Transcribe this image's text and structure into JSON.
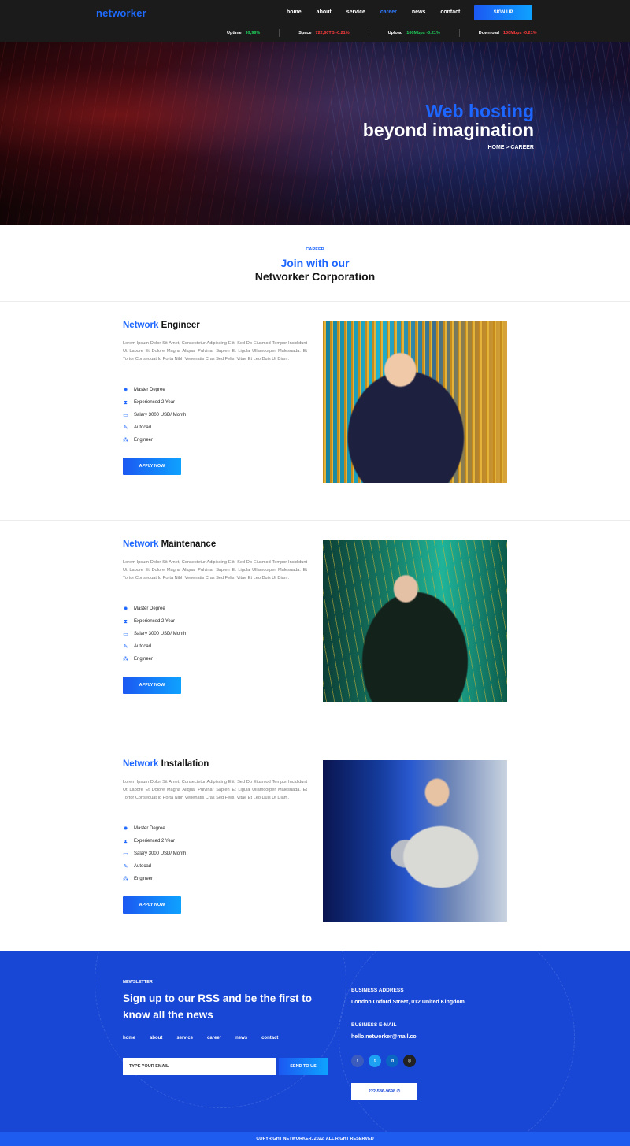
{
  "header": {
    "logo": "networker",
    "nav": [
      "home",
      "about",
      "service",
      "career",
      "news",
      "contact"
    ],
    "active_nav": "career",
    "signup_label": "SIGN UP",
    "stats": [
      {
        "label": "Uptime",
        "value": "99,99%",
        "color": "green"
      },
      {
        "label": "Space",
        "value": "722,60TB -0.21%",
        "color": "red"
      },
      {
        "label": "Upload",
        "value": "100Mbps -0.21%",
        "color": "green"
      },
      {
        "label": "Download",
        "value": "100Mbps -0.21%",
        "color": "red"
      }
    ]
  },
  "hero": {
    "title_line1": "Web hosting",
    "title_line2": "beyond imagination",
    "breadcrumb": "HOME > CAREER"
  },
  "intro": {
    "label": "CAREER",
    "title_line1": "Join with our",
    "title_line2": "Networker Corporation"
  },
  "jobs": [
    {
      "title_blue": "Network",
      "title_rest": " Engineer",
      "description": "Lorem Ipsum Dolor Sit Amet, Consectetur Adipiscing Elit, Sed Do Eiusmod Tempor Incididunt Ut Labore Et Dolore Magna Aliqua. Pulvinar Sapien Et Ligula Ullamcorper Malesuada. Et Tortor Consequat Id Porta Nibh Venenatis Cras Sed Felis. Vitae Et Leo Duis Ut Diam.",
      "features": [
        "Master Degree",
        "Experienced 2 Year",
        "Salary 3000 USD/ Month",
        "Autocad",
        "Engineer"
      ],
      "apply_label": "APPLY NOW"
    },
    {
      "title_blue": "Network",
      "title_rest": " Maintenance",
      "description": "Lorem Ipsum Dolor Sit Amet, Consectetur Adipiscing Elit, Sed Do Eiusmod Tempor Incididunt Ut Labore Et Dolore Magna Aliqua. Pulvinar Sapien Et Ligula Ullamcorper Malesuada. Et Tortor Consequat Id Porta Nibh Venenatis Cras Sed Felis. Vitae Et Leo Duis Ut Diam.",
      "features": [
        "Master Degree",
        "Experienced 2 Year",
        "Salary 3000 USD/ Month",
        "Autocad",
        "Engineer"
      ],
      "apply_label": "APPLY NOW"
    },
    {
      "title_blue": "Network",
      "title_rest": " Installation",
      "description": "Lorem Ipsum Dolor Sit Amet, Consectetur Adipiscing Elit, Sed Do Eiusmod Tempor Incididunt Ut Labore Et Dolore Magna Aliqua. Pulvinar Sapien Et Ligula Ullamcorper Malesuada. Et Tortor Consequat Id Porta Nibh Venenatis Cras Sed Felis. Vitae Et Leo Duis Ut Diam.",
      "features": [
        "Master Degree",
        "Experienced 2 Year",
        "Salary 3000 USD/ Month",
        "Autocad",
        "Engineer"
      ],
      "apply_label": "APPLY NOW"
    }
  ],
  "feature_icons": [
    "gear-icon",
    "hourglass-icon",
    "card-icon",
    "brush-icon",
    "network-icon"
  ],
  "footer": {
    "newsletter_label": "NEWSLETTER",
    "newsletter_title": "Sign up to our RSS and be the first to know all the news",
    "nav": [
      "home",
      "about",
      "service",
      "career",
      "news",
      "contact"
    ],
    "email_placeholder": "TYPE YOUR EMAIL",
    "send_label": "SEND TO US",
    "address_label": "BUSINESS ADDRESS",
    "address_value": "London Oxford Street, 012 United Kingdom.",
    "email_label": "BUSINESS E-MAIL",
    "email_value": "hello.networker@mail.co",
    "socials": [
      {
        "name": "facebook-icon",
        "glyph": "f",
        "color": "#3b5bbd"
      },
      {
        "name": "twitter-icon",
        "glyph": "t",
        "color": "#1da1f2"
      },
      {
        "name": "linkedin-icon",
        "glyph": "in",
        "color": "#0a66c2"
      },
      {
        "name": "instagram-icon",
        "glyph": "◎",
        "color": "#222222"
      }
    ],
    "phone": "222-586-9698",
    "copyright": "COPYRIGHT NETWORKER, 2022, ALL RIGHT RESERVED"
  },
  "colors": {
    "accent": "#1d66ff",
    "footer_bg": "#1847d6",
    "header_bg": "#1b1b1c",
    "positive": "#1ed45d",
    "negative": "#ff3b3b"
  }
}
